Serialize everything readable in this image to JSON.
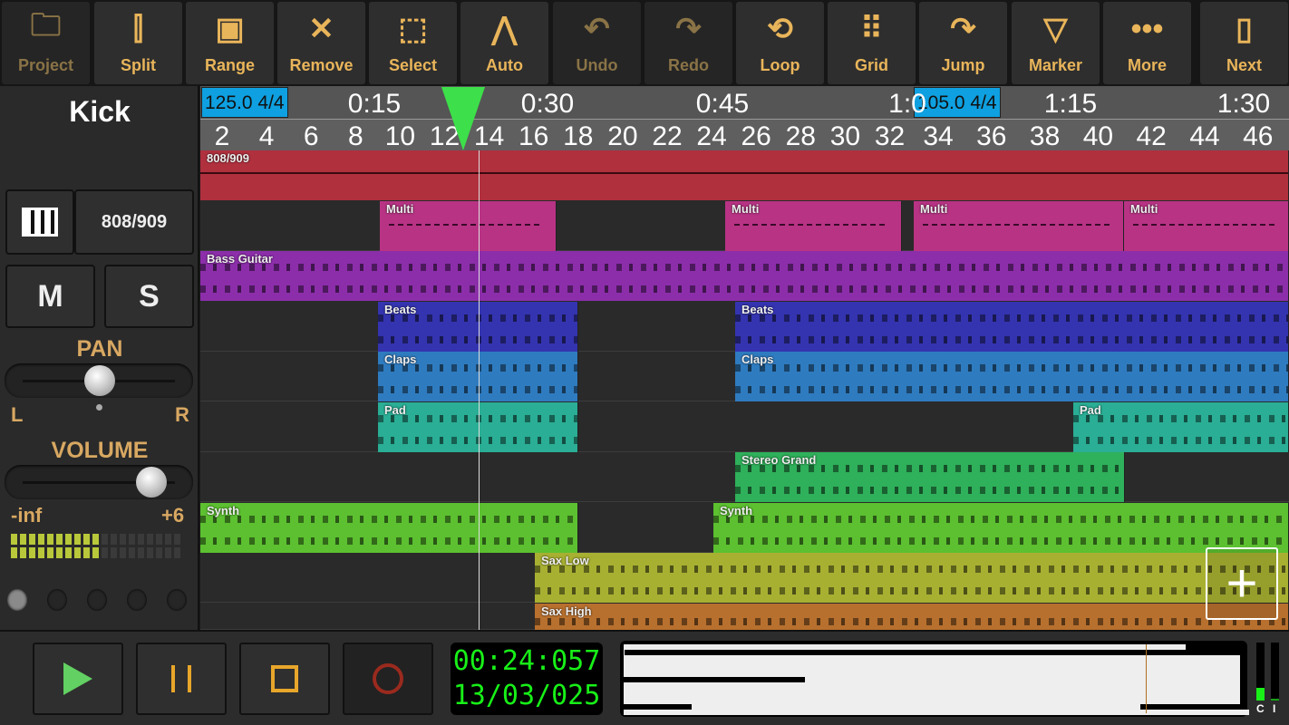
{
  "toolbar": [
    {
      "label": "Project",
      "icon": "folder-icon",
      "enabled": false
    },
    {
      "label": "Split",
      "icon": "split-icon",
      "enabled": true
    },
    {
      "label": "Range",
      "icon": "range-icon",
      "enabled": true
    },
    {
      "label": "Remove",
      "icon": "close-icon",
      "enabled": true
    },
    {
      "label": "Select",
      "icon": "select-icon",
      "enabled": true
    },
    {
      "label": "Auto",
      "icon": "automation-icon",
      "enabled": true
    },
    {
      "label": "Undo",
      "icon": "undo-icon",
      "enabled": false
    },
    {
      "label": "Redo",
      "icon": "redo-icon",
      "enabled": false
    },
    {
      "label": "Loop",
      "icon": "loop-icon",
      "enabled": true
    },
    {
      "label": "Grid",
      "icon": "grid-icon",
      "enabled": true
    },
    {
      "label": "Jump",
      "icon": "jump-icon",
      "enabled": true
    },
    {
      "label": "Marker",
      "icon": "marker-icon",
      "enabled": true
    },
    {
      "label": "More",
      "icon": "more-icon",
      "enabled": true
    },
    {
      "label": "Next",
      "icon": "next-icon",
      "enabled": true
    }
  ],
  "track_panel": {
    "name": "Kick",
    "instrument": "808/909",
    "mute": "M",
    "solo": "S",
    "pan_label": "PAN",
    "pan_left": "L",
    "pan_right": "R",
    "pan_value": 0.5,
    "volume_label": "VOLUME",
    "vol_min": "-inf",
    "vol_max": "+6",
    "volume_value": 0.78,
    "meter_level": 0.5
  },
  "ruler": {
    "tempos": [
      "125.0  4/4",
      "105.0  4/4"
    ],
    "times": [
      "0:15",
      "0:30",
      "0:45",
      "1:0",
      "1:15",
      "1:30"
    ],
    "bars": [
      "2",
      "4",
      "6",
      "8",
      "10",
      "12",
      "14",
      "16",
      "18",
      "20",
      "22",
      "24",
      "26",
      "28",
      "30",
      "32",
      "34",
      "36",
      "38",
      "40",
      "42",
      "44",
      "46"
    ]
  },
  "tracks": [
    {
      "color": "#b0303e",
      "clips": [
        "808/909"
      ]
    },
    {
      "color": "#b83384",
      "clips": [
        "Multi",
        "Multi",
        "Multi",
        "Multi"
      ]
    },
    {
      "color": "#8c2eaa",
      "clips": [
        "Bass Guitar"
      ]
    },
    {
      "color": "#3434b0",
      "clips": [
        "Beats",
        "Beats"
      ]
    },
    {
      "color": "#2f7bbf",
      "clips": [
        "Claps",
        "Claps"
      ]
    },
    {
      "color": "#2aae95",
      "clips": [
        "Pad",
        "Pad"
      ]
    },
    {
      "color": "#2fb05a",
      "clips": [
        "Stereo Grand"
      ]
    },
    {
      "color": "#5cc030",
      "clips": [
        "Synth",
        "Synth"
      ]
    },
    {
      "color": "#a8b032",
      "clips": [
        "Sax Low"
      ]
    },
    {
      "color": "#b8702e",
      "clips": [
        "Sax High"
      ]
    }
  ],
  "transport": {
    "time": "00:24:057",
    "position": "13/03/025",
    "meter_labels": [
      "C",
      "I"
    ]
  },
  "colors": {
    "accent": "#e9b55a",
    "lcd": "#18f018",
    "playhead": "#3de04a"
  }
}
